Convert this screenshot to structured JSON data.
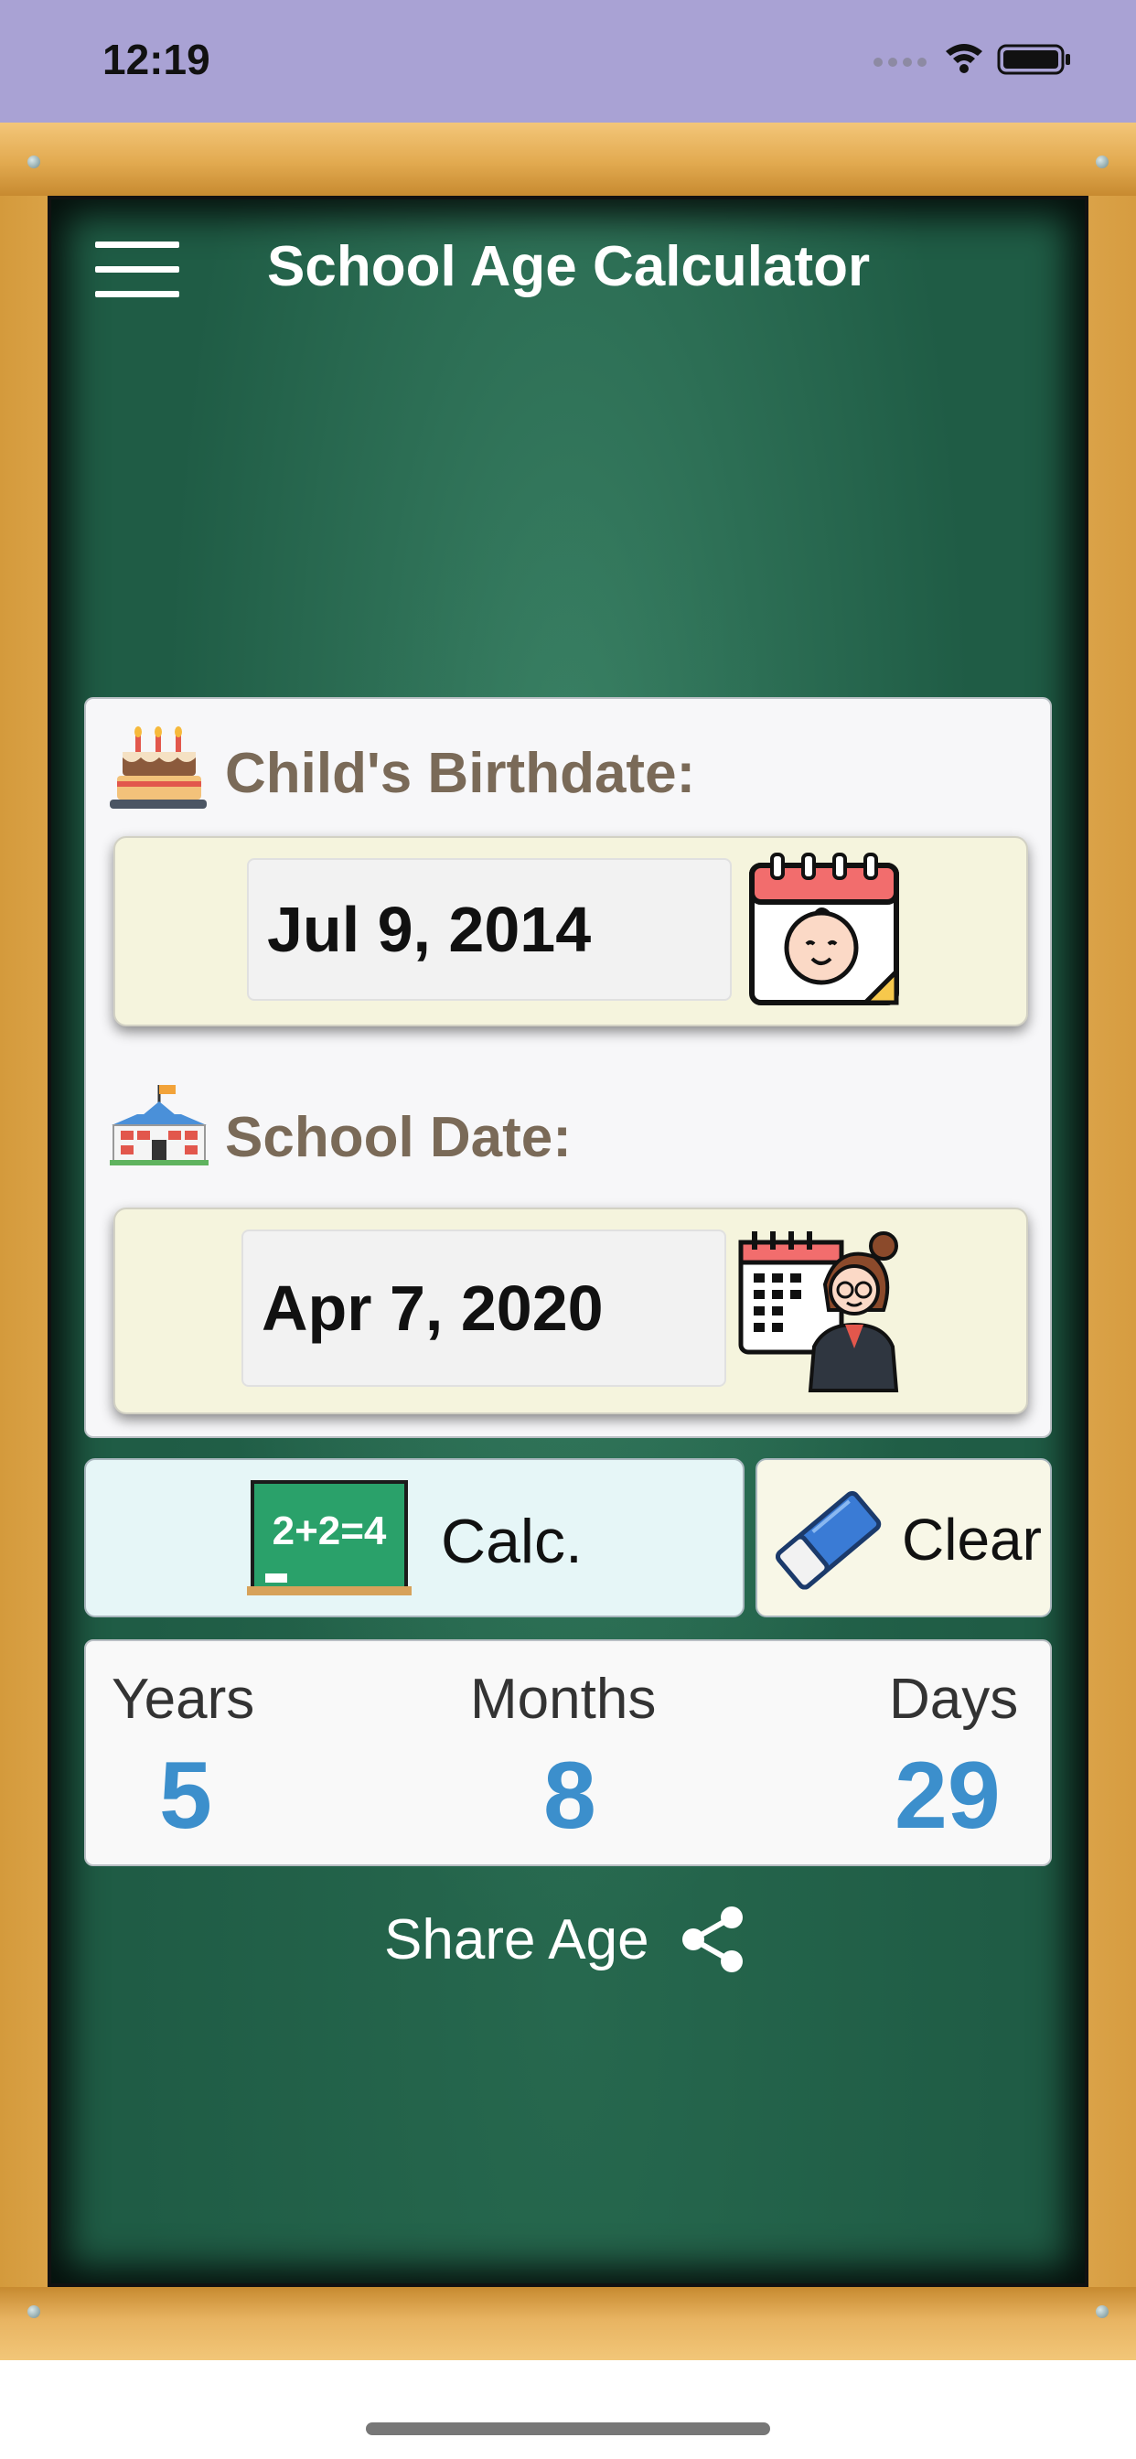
{
  "status_bar": {
    "time": "12:19"
  },
  "header": {
    "title": "School Age Calculator"
  },
  "birthdate": {
    "label": "Child's Birthdate:",
    "value": "Jul 9, 2014"
  },
  "school_date": {
    "label": "School Date:",
    "value": "Apr 7, 2020"
  },
  "actions": {
    "calc_label": "Calc.",
    "clear_label": "Clear",
    "chalkboard_text": "2+2=4"
  },
  "results": {
    "years_label": "Years",
    "years_value": "5",
    "months_label": "Months",
    "months_value": "8",
    "days_label": "Days",
    "days_value": "29"
  },
  "share": {
    "label": "Share Age"
  },
  "colors": {
    "status_bar": "#a9a2d4",
    "board": "#1f5c45",
    "result_accent": "#3c8fcc",
    "label_brown": "#7a6a58"
  }
}
